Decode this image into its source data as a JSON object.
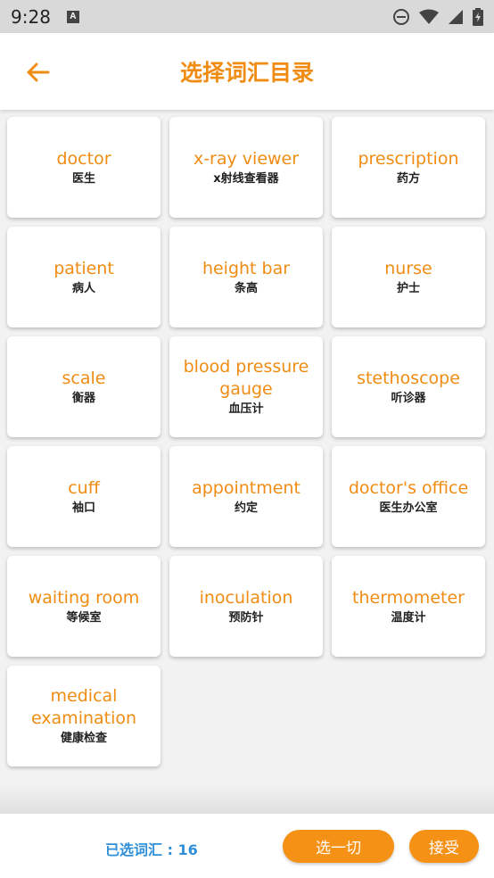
{
  "status_bar": {
    "time": "9:28"
  },
  "header": {
    "title": "选择词汇目录"
  },
  "words": [
    {
      "en": "doctor",
      "zh": "医生"
    },
    {
      "en": "x-ray viewer",
      "zh": "x射线查看器"
    },
    {
      "en": "prescription",
      "zh": "药方"
    },
    {
      "en": "patient",
      "zh": "病人"
    },
    {
      "en": "height bar",
      "zh": "条高"
    },
    {
      "en": "nurse",
      "zh": "护士"
    },
    {
      "en": "scale",
      "zh": "衡器"
    },
    {
      "en": "blood pressure gauge",
      "zh": "血压计"
    },
    {
      "en": "stethoscope",
      "zh": "听诊器"
    },
    {
      "en": "cuff",
      "zh": "袖口"
    },
    {
      "en": "appointment",
      "zh": "约定"
    },
    {
      "en": "doctor's office",
      "zh": "医生办公室"
    },
    {
      "en": "waiting room",
      "zh": "等候室"
    },
    {
      "en": "inoculation",
      "zh": "预防针"
    },
    {
      "en": "thermometer",
      "zh": "温度计"
    },
    {
      "en": "medical examination",
      "zh": "健康检查"
    }
  ],
  "footer": {
    "selected_count": "已选词汇 : 16",
    "select_all_label": "选一切",
    "accept_label": "接受"
  },
  "colors": {
    "accent": "#f08c13",
    "count_text": "#2f8fd8"
  },
  "icons": {
    "back": "arrow-left-icon"
  }
}
